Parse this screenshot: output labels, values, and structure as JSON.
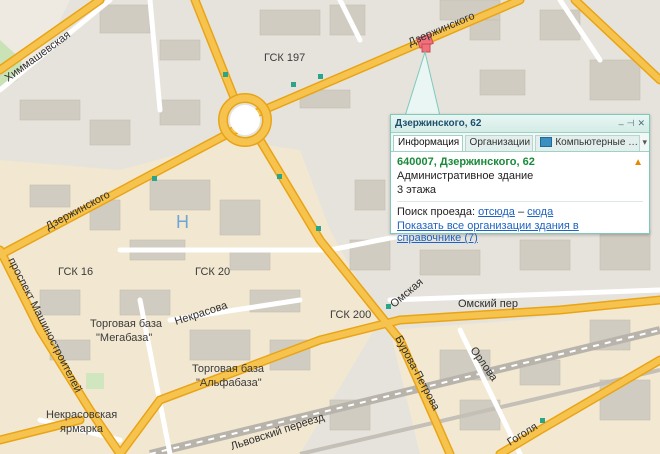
{
  "popup": {
    "title": "Дзержинского, 62",
    "tabs": [
      {
        "label": "Информация",
        "active": true
      },
      {
        "label": "Организации",
        "active": false
      },
      {
        "label": "Компьютерные …",
        "active": false,
        "icon": "computer-icon"
      }
    ],
    "address": "640007, Дзержинского, 62",
    "building_type": "Административное здание",
    "floors": "3 этажа",
    "route_label": "Поиск проезда:",
    "route_from": "отсюда",
    "route_dash": "–",
    "route_to": "сюда",
    "show_all_link": "Показать все организации здания в справочнике (7)"
  },
  "map_labels": {
    "street_khimmashevskaya": "Химмашевская",
    "street_dzerzhinskogo_top": "Дзержинского",
    "street_dzerzhinskogo_left": "Дзержинского",
    "street_mashinostroiteley": "проспект Машиностроителей",
    "street_nekrasova": "Некрасова",
    "street_omskaya": "Омская",
    "street_omsky_per": "Омский пер",
    "street_orlova": "Орлова",
    "street_burova_petrova": "Бурова-Петрова",
    "street_gogolya": "Гоголя",
    "street_lvovsky": "Львовский переезд",
    "gsk_197": "ГСК 197",
    "gsk_16": "ГСК 16",
    "gsk_20": "ГСК 20",
    "gsk_200": "ГСК 200",
    "base_mega_1": "Торговая база",
    "base_mega_2": "\"Мегабаза\"",
    "base_alfa_1": "Торговая база",
    "base_alfa_2": "\"Альфабаза\"",
    "market_1": "Некрасовская",
    "market_2": "ярмарка",
    "h_letter": "Н"
  },
  "colors": {
    "major_road": "#f4b52a",
    "minor_road": "#ffffff",
    "built_area": "#f1e6cf",
    "building": "#d0cbbf",
    "park": "#c9e3b6",
    "marker": "#f0707b",
    "popup_border": "#7fc9bb",
    "address_green": "#1a8a3a",
    "link_blue": "#1e63c2"
  }
}
